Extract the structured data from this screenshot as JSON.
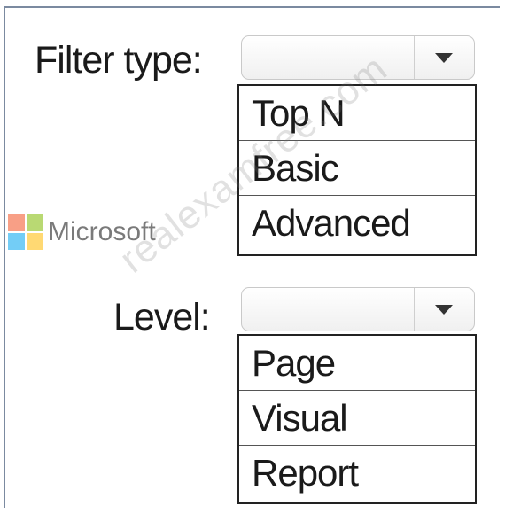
{
  "filter": {
    "label": "Filter type:",
    "selected": "",
    "options": [
      "Top N",
      "Basic",
      "Advanced"
    ]
  },
  "level": {
    "label": "Level:",
    "selected": "",
    "options": [
      "Page",
      "Visual",
      "Report"
    ]
  },
  "logo": {
    "text": "Microsoft",
    "colors": [
      "#f25022",
      "#7fba00",
      "#00a4ef",
      "#ffb900"
    ]
  },
  "watermark": {
    "text": "realexamfree.com"
  },
  "colors": {
    "frame_border": "#7b8aa0",
    "list_border": "#222222",
    "text": "#1a1a1a"
  }
}
